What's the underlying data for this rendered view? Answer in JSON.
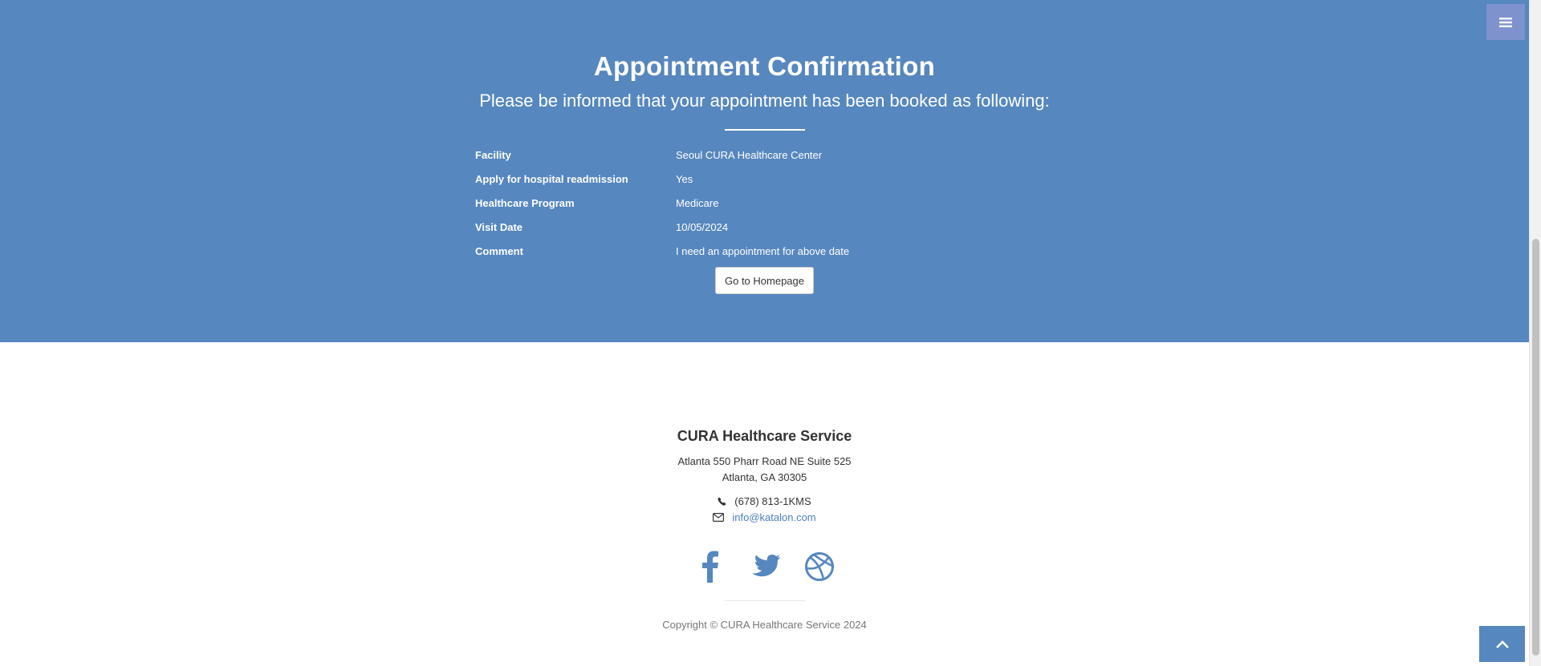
{
  "header": {
    "title": "Appointment Confirmation",
    "lead": "Please be informed that your appointment has been booked as following:",
    "menu_icon": "hamburger-icon"
  },
  "appointment": {
    "rows": [
      {
        "label": "Facility",
        "value": "Seoul CURA Healthcare Center"
      },
      {
        "label": "Apply for hospital readmission",
        "value": "Yes"
      },
      {
        "label": "Healthcare Program",
        "value": "Medicare"
      },
      {
        "label": "Visit Date",
        "value": "10/05/2024"
      },
      {
        "label": "Comment",
        "value": "I need an appointment for above date"
      }
    ],
    "home_button": "Go to Homepage"
  },
  "footer": {
    "title": "CURA Healthcare Service",
    "address_line1": "Atlanta 550 Pharr Road NE Suite 525",
    "address_line2": "Atlanta, GA 30305",
    "phone": "(678) 813-1KMS",
    "email": "info@katalon.com",
    "social": [
      "facebook-icon",
      "twitter-icon",
      "dribbble-icon"
    ],
    "copyright": "Copyright © CURA Healthcare Service 2024"
  },
  "colors": {
    "hero_bg": "#5687bf",
    "menu_bg": "#7e92cd",
    "link": "#4a7fc1"
  }
}
